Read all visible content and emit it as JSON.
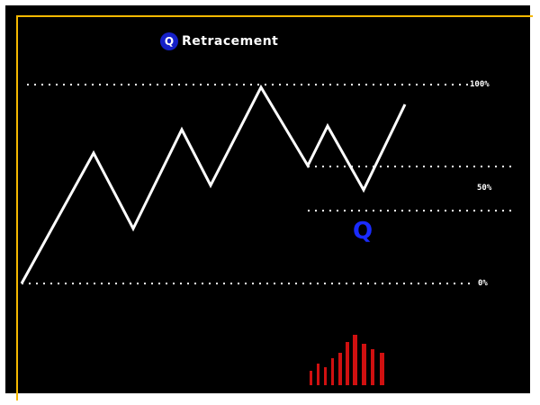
{
  "title": {
    "badge": "Q",
    "text": "Retracement"
  },
  "levels": [
    {
      "label": "100%"
    },
    {
      "label": "50%"
    },
    {
      "label": "0%"
    }
  ],
  "marker": "Q",
  "colors": {
    "background": "#000000",
    "frame": "#f5b800",
    "line": "#ffffff",
    "accent": "#1520c8",
    "bars": "#d01010"
  },
  "volume_bars_count": 9
}
